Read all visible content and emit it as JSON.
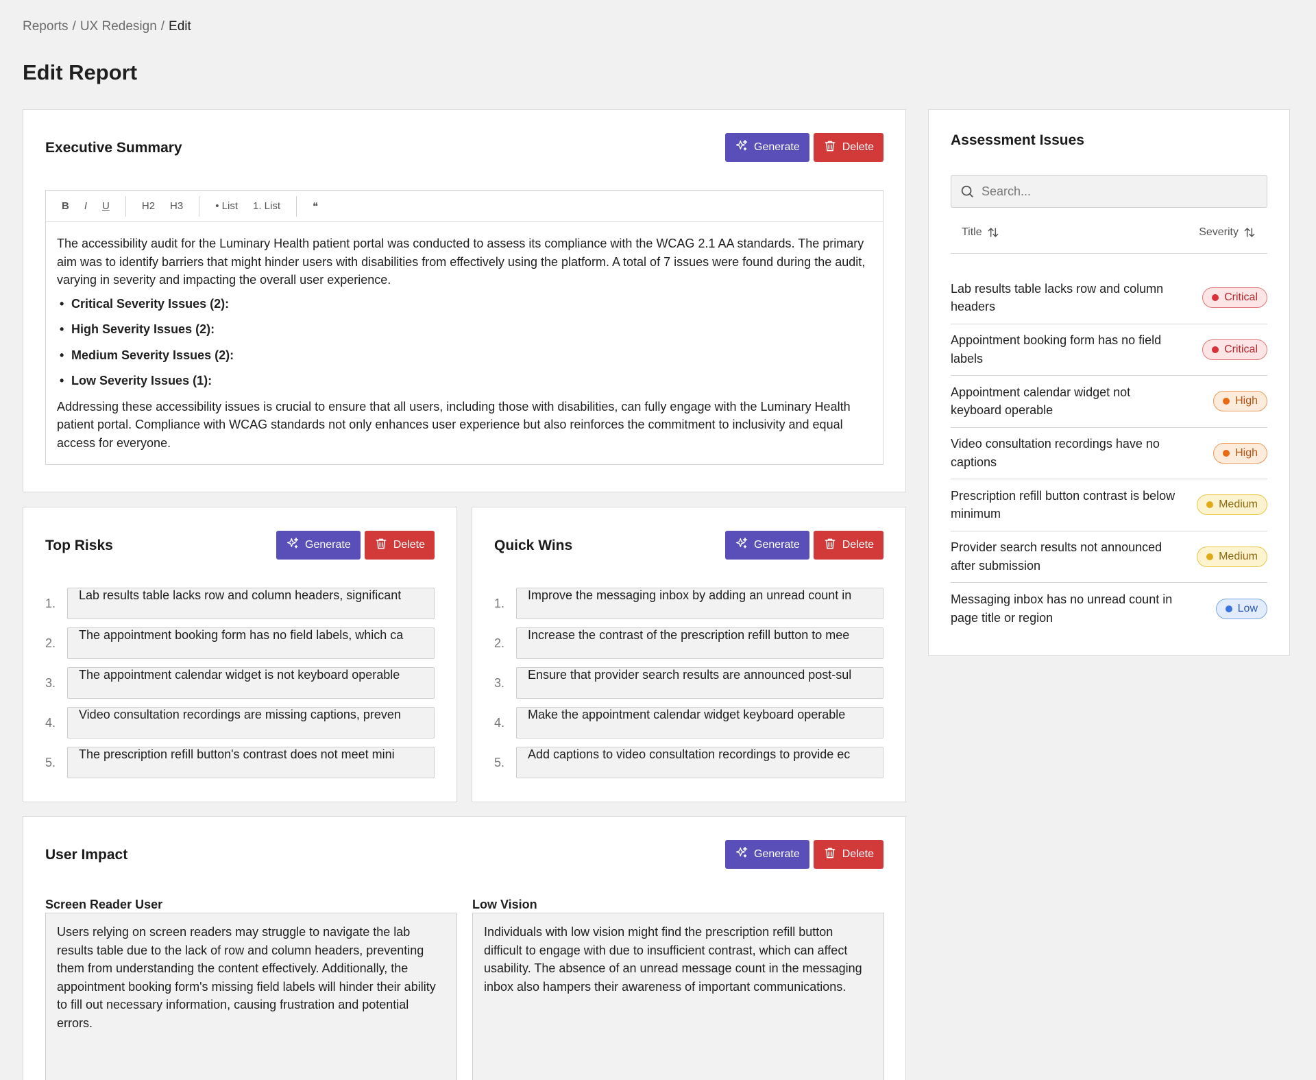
{
  "breadcrumb": {
    "items": [
      "Reports",
      "UX Redesign"
    ],
    "current": "Edit",
    "separator": "/"
  },
  "page_title": "Edit Report",
  "buttons": {
    "generate": "Generate",
    "delete": "Delete"
  },
  "colors": {
    "generate": "#5a4fb8",
    "delete": "#d23a3a"
  },
  "executive_summary": {
    "title": "Executive Summary",
    "toolbar": [
      "B",
      "I",
      "U",
      "H2",
      "H3",
      "• List",
      "1. List",
      "❝"
    ],
    "para1": "The accessibility audit for the Luminary Health patient portal was conducted to assess its compliance with the WCAG 2.1 AA standards. The primary aim was to identify barriers that might hinder users with disabilities from effectively using the platform. A total of 7 issues were found during the audit, varying in severity and impacting the overall user experience.",
    "bullets": [
      "Critical Severity Issues (2):",
      "High Severity Issues (2):",
      "Medium Severity Issues (2):",
      "Low Severity Issues (1):"
    ],
    "para2": "Addressing these accessibility issues is crucial to ensure that all users, including those with disabilities, can fully engage with the Luminary Health patient portal. Compliance with WCAG standards not only enhances user experience but also reinforces the commitment to inclusivity and equal access for everyone."
  },
  "top_risks": {
    "title": "Top Risks",
    "items": [
      "Lab results table lacks row and column headers, significant",
      "The appointment booking form has no field labels, which ca",
      "The appointment calendar widget is not keyboard operable",
      "Video consultation recordings are missing captions, preven",
      "The prescription refill button's contrast does not meet mini"
    ]
  },
  "quick_wins": {
    "title": "Quick Wins",
    "items": [
      "Improve the messaging inbox by adding an unread count in",
      "Increase the contrast of the prescription refill button to mee",
      "Ensure that provider search results are announced post-sul",
      "Make the appointment calendar widget keyboard operable",
      "Add captions to video consultation recordings to provide ec"
    ]
  },
  "user_impact": {
    "title": "User Impact",
    "screen_reader": {
      "label": "Screen Reader User",
      "text": "Users relying on screen readers may struggle to navigate the lab results table due to the lack of row and column headers, preventing them from understanding the content effectively. Additionally, the appointment booking form's missing field labels will hinder their ability to fill out necessary information, causing frustration and potential errors."
    },
    "low_vision": {
      "label": "Low Vision",
      "text": "Individuals with low vision might find the prescription refill button difficult to engage with due to insufficient contrast, which can affect usability. The absence of an unread message count in the messaging inbox also hampers their awareness of important communications."
    }
  },
  "assessment_issues": {
    "title": "Assessment Issues",
    "search_placeholder": "Search...",
    "columns": {
      "title": "Title",
      "severity": "Severity"
    },
    "severity_colors": {
      "Critical": {
        "bg": "#fde5e5",
        "border": "#e07a7a",
        "dot": "#d9303a",
        "text": "#b3262d"
      },
      "High": {
        "bg": "#fdebdc",
        "border": "#ec9a5c",
        "dot": "#ea6a14",
        "text": "#b85212"
      },
      "Medium": {
        "bg": "#fdf4cf",
        "border": "#e7c54a",
        "dot": "#e0a91a",
        "text": "#8a6a10"
      },
      "Low": {
        "bg": "#e2ecfc",
        "border": "#7aa3e8",
        "dot": "#3a73e0",
        "text": "#2b5bb8"
      }
    },
    "rows": [
      {
        "title": "Lab results table lacks row and column headers",
        "severity": "Critical"
      },
      {
        "title": "Appointment booking form has no field labels",
        "severity": "Critical"
      },
      {
        "title": "Appointment calendar widget not keyboard operable",
        "severity": "High"
      },
      {
        "title": "Video consultation recordings have no captions",
        "severity": "High"
      },
      {
        "title": "Prescription refill button contrast is below minimum",
        "severity": "Medium"
      },
      {
        "title": "Provider search results not announced after submission",
        "severity": "Medium"
      },
      {
        "title": "Messaging inbox has no unread count in page title or region",
        "severity": "Low"
      }
    ]
  }
}
